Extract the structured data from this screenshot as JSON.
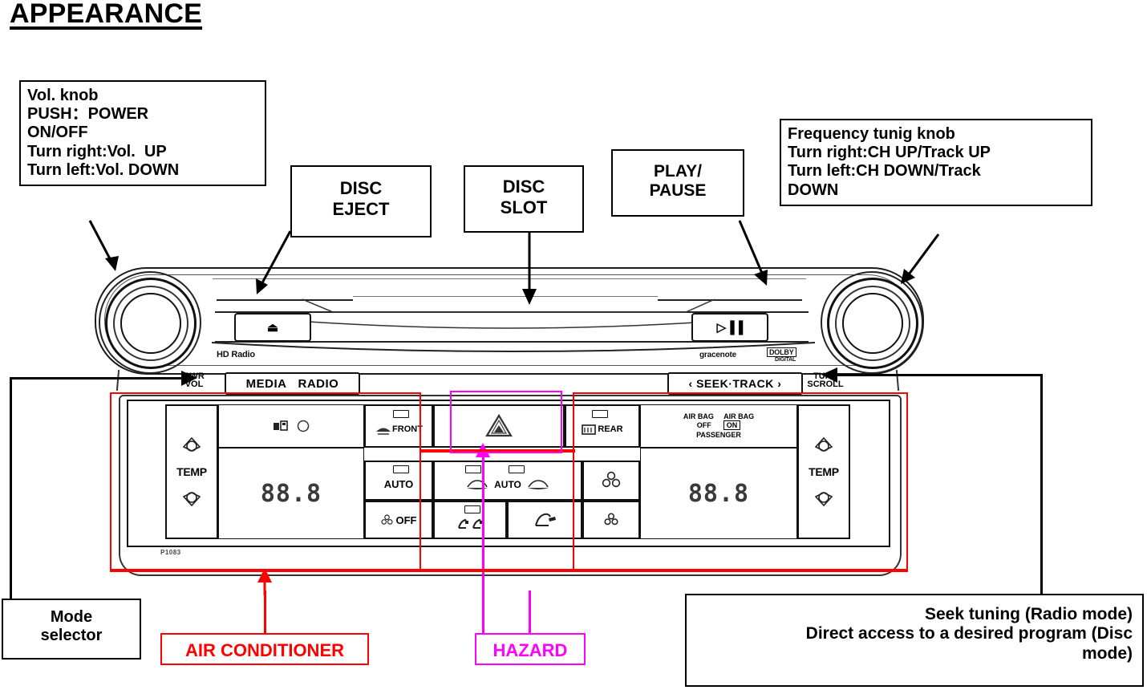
{
  "page": {
    "title": "APPEARANCE"
  },
  "callouts": {
    "vol_knob": {
      "lines": [
        "Vol. knob",
        "PUSH：POWER",
        "ON/OFF",
        "Turn right:Vol.  UP",
        "Turn left:Vol. DOWN"
      ]
    },
    "disc_eject": {
      "lines": [
        "DISC",
        "EJECT"
      ]
    },
    "disc_slot": {
      "lines": [
        "DISC",
        "SLOT"
      ]
    },
    "play_pause": {
      "lines": [
        "PLAY/",
        "PAUSE"
      ]
    },
    "freq_knob": {
      "lines": [
        "Frequency tunig knob",
        "Turn right:CH UP/Track UP",
        "Turn left:CH DOWN/Track",
        "DOWN"
      ]
    },
    "mode_selector": {
      "lines": [
        "Mode",
        "selector"
      ]
    },
    "air_conditioner": {
      "lines": [
        "AIR CONDITIONER"
      ],
      "color": "#ff0000"
    },
    "hazard": {
      "lines": [
        "HAZARD"
      ],
      "color": "#ff00ff"
    },
    "seek_tuning": {
      "lines": [
        "Seek tuning (Radio mode)",
        "Direct access to a desired program (Disc",
        "mode)"
      ]
    }
  },
  "head_unit": {
    "eject_icon": "⏏",
    "play_pause_icon": "▷▐▐",
    "hd_radio_logo": "HD Radio",
    "gracenote_logo": "gracenote",
    "dolby_logo": "DOLBY",
    "dolby_sub": "DIGITAL",
    "pwr_vol_label": "PWR\nVOL",
    "tune_scroll_label": "TUNE\nSCROLL",
    "media_label": "MEDIA",
    "radio_label": "RADIO",
    "seek_track_label": "‹ SEEK·TRACK ›"
  },
  "climate": {
    "watermark": "P1083",
    "left_temp": {
      "label": "TEMP",
      "up": "△",
      "down": "▽"
    },
    "right_temp": {
      "label": "TEMP",
      "up": "△",
      "down": "▽"
    },
    "left_display": "88.8",
    "right_display": "88.8",
    "buttons": {
      "front_defrost": "FRONT",
      "rear_defrost": "REAR",
      "auto_left": "AUTO",
      "auto_right": "AUTO",
      "fan_off": "OFF",
      "hazard_icon": "hazard-triangle",
      "mode_face": "mode-face-icon",
      "mode_feet": "mode-feet-icon",
      "fan_up": "fan-high-icon",
      "fan_down": "fan-low-icon",
      "recirc": "recirculation-icon",
      "fresh": "fresh-air-icon",
      "seat": "seat-icon"
    },
    "airbag": {
      "left_label": "AIR BAG",
      "left_state": "OFF",
      "right_label": "AIR BAG",
      "right_state": "ON",
      "sub": "PASSENGER"
    }
  }
}
